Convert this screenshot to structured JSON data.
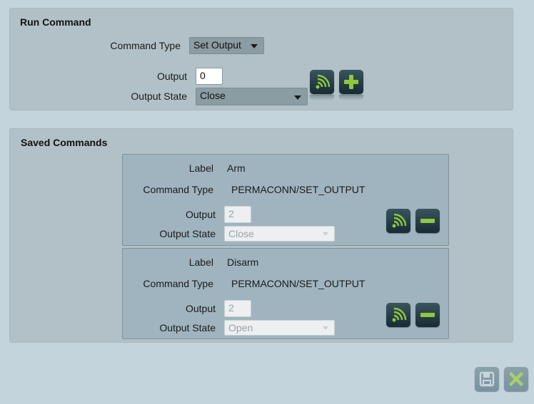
{
  "run_command": {
    "title": "Run Command",
    "command_type_label": "Command Type",
    "command_type_value": "Set Output",
    "output_label": "Output",
    "output_value": "0",
    "output_state_label": "Output State",
    "output_state_value": "Close"
  },
  "saved_commands": {
    "title": "Saved Commands",
    "items": [
      {
        "label_label": "Label",
        "label_value": "Arm",
        "command_type_label": "Command Type",
        "command_type_value": "PERMACONN/SET_OUTPUT",
        "output_label": "Output",
        "output_value": "2",
        "output_state_label": "Output State",
        "output_state_value": "Close"
      },
      {
        "label_label": "Label",
        "label_value": "Disarm",
        "command_type_label": "Command Type",
        "command_type_value": "PERMACONN/SET_OUTPUT",
        "output_label": "Output",
        "output_value": "2",
        "output_state_label": "Output State",
        "output_state_value": "Open"
      }
    ]
  },
  "icons": {
    "send": "signal-icon",
    "add": "plus-icon",
    "remove": "minus-icon",
    "save": "save-icon",
    "close": "close-icon"
  },
  "colors": {
    "accent_green": "#8fc83f",
    "button_dark": "#1e3640"
  }
}
